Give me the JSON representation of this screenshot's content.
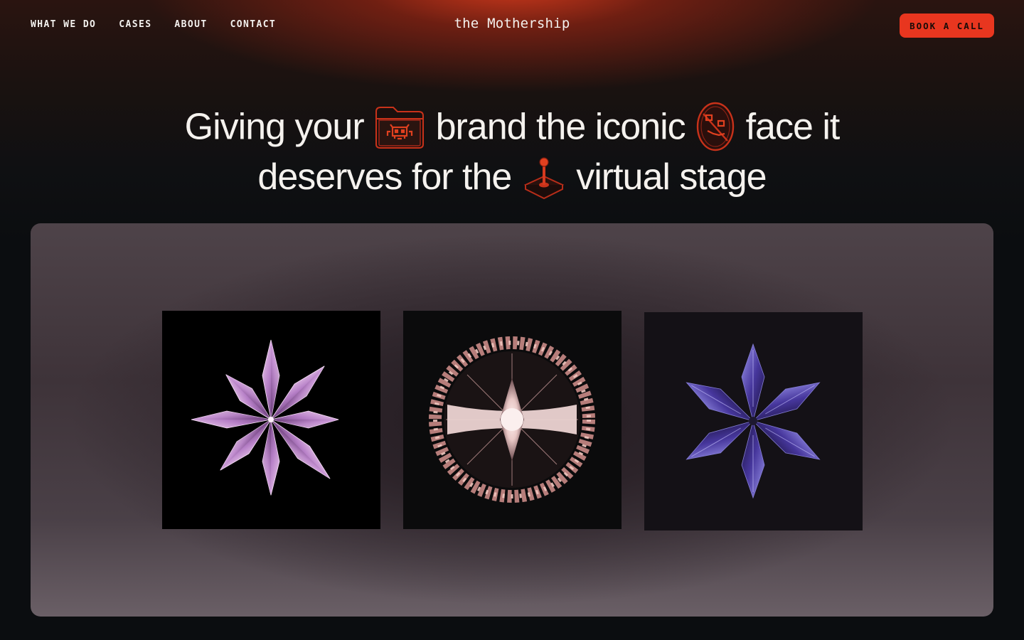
{
  "nav": {
    "links": [
      "WHAT WE DO",
      "CASES",
      "ABOUT",
      "CONTACT"
    ],
    "brand": "the Mothership",
    "cta": "BOOK A CALL"
  },
  "hero": {
    "line1_part1": "Giving your",
    "line1_part2": "brand the iconic",
    "line1_part3": "face it",
    "line2_part1": "deserves for the",
    "line2_part2": "virtual stage",
    "icons": [
      "folder-invader-icon",
      "pixel-face-icon",
      "joystick-icon"
    ]
  },
  "showcase": {
    "tiles": [
      "pink-crystal-star",
      "crystal-ring-portal",
      "violet-crystal-star"
    ]
  },
  "colors": {
    "accent": "#e8361f",
    "background": "#0b0d10",
    "text": "#f3f1ee",
    "icon_stroke": "#c8321a"
  }
}
